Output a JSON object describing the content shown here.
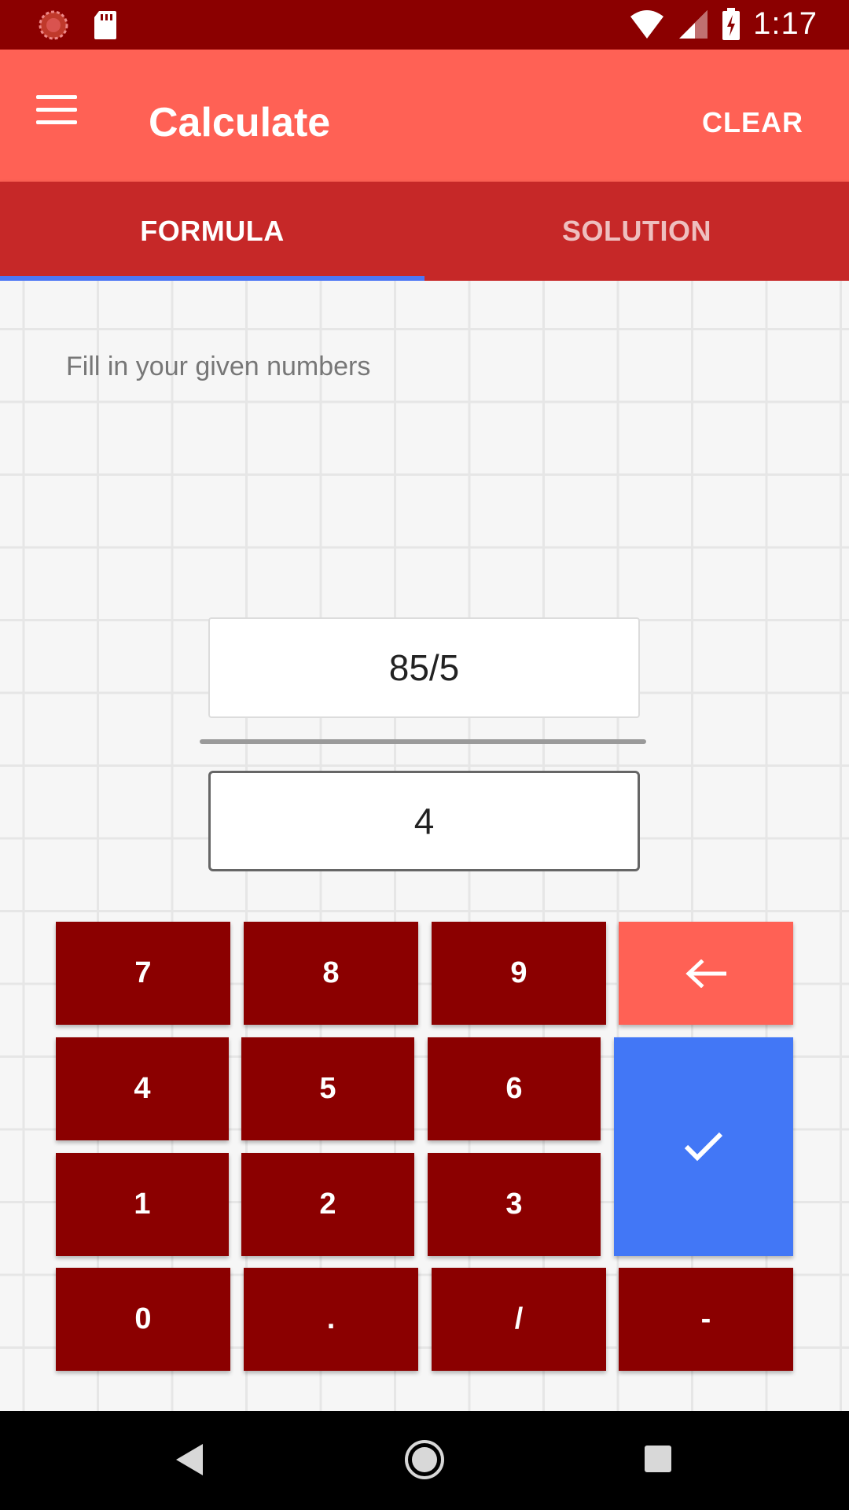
{
  "status_bar": {
    "time": "1:17",
    "icons": [
      "sync-icon",
      "sd-card-icon",
      "wifi-icon",
      "signal-icon",
      "battery-charging-icon"
    ]
  },
  "app_bar": {
    "title": "Calculate",
    "clear_label": "CLEAR",
    "menu_icon": "menu-icon"
  },
  "tabs": [
    {
      "label": "FORMULA",
      "active": true
    },
    {
      "label": "SOLUTION",
      "active": false
    }
  ],
  "main": {
    "hint": "Fill in your given numbers",
    "numerator_value": "85/5",
    "denominator_value": "4"
  },
  "keypad": {
    "row1": [
      "7",
      "8",
      "9"
    ],
    "row2": [
      "4",
      "5",
      "6"
    ],
    "row3": [
      "1",
      "2",
      "3"
    ],
    "row4": [
      "0",
      ".",
      "/",
      "-"
    ],
    "backspace_icon": "arrow-left-icon",
    "confirm_icon": "check-icon"
  },
  "colors": {
    "status_bar": "#8b0000",
    "app_bar": "#ff6155",
    "tab_bar": "#c62828",
    "tab_indicator": "#4d76f5",
    "key": "#8b0000",
    "backspace_key": "#ff6155",
    "confirm_key": "#4277f6"
  },
  "nav_bar": {
    "icons": [
      "back-icon",
      "home-icon",
      "recents-icon"
    ]
  }
}
